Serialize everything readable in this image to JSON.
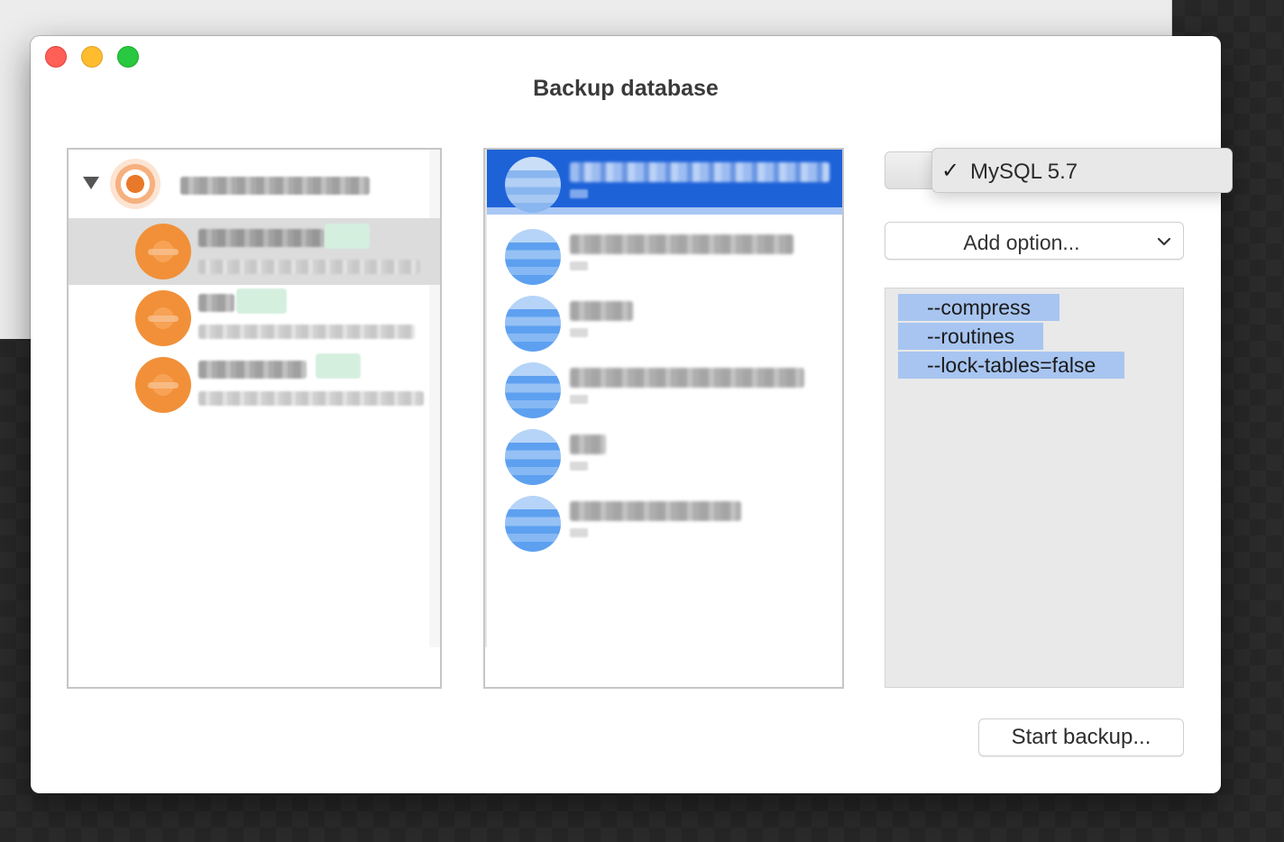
{
  "dialog": {
    "title": "Backup database"
  },
  "version_menu": {
    "selected_label": "MySQL 5.7",
    "check_glyph": "✓"
  },
  "add_option": {
    "label": "Add option..."
  },
  "options": [
    "--compress",
    "--routines",
    "--lock-tables=false"
  ],
  "actions": {
    "start_backup_label": "Start backup..."
  },
  "colors": {
    "selection_blue": "#1e62d8",
    "token_blue": "#a7c5f0",
    "connection_orange": "#f19039",
    "close": "#fe5f57",
    "minimize": "#febc2e",
    "zoom": "#28c840"
  }
}
